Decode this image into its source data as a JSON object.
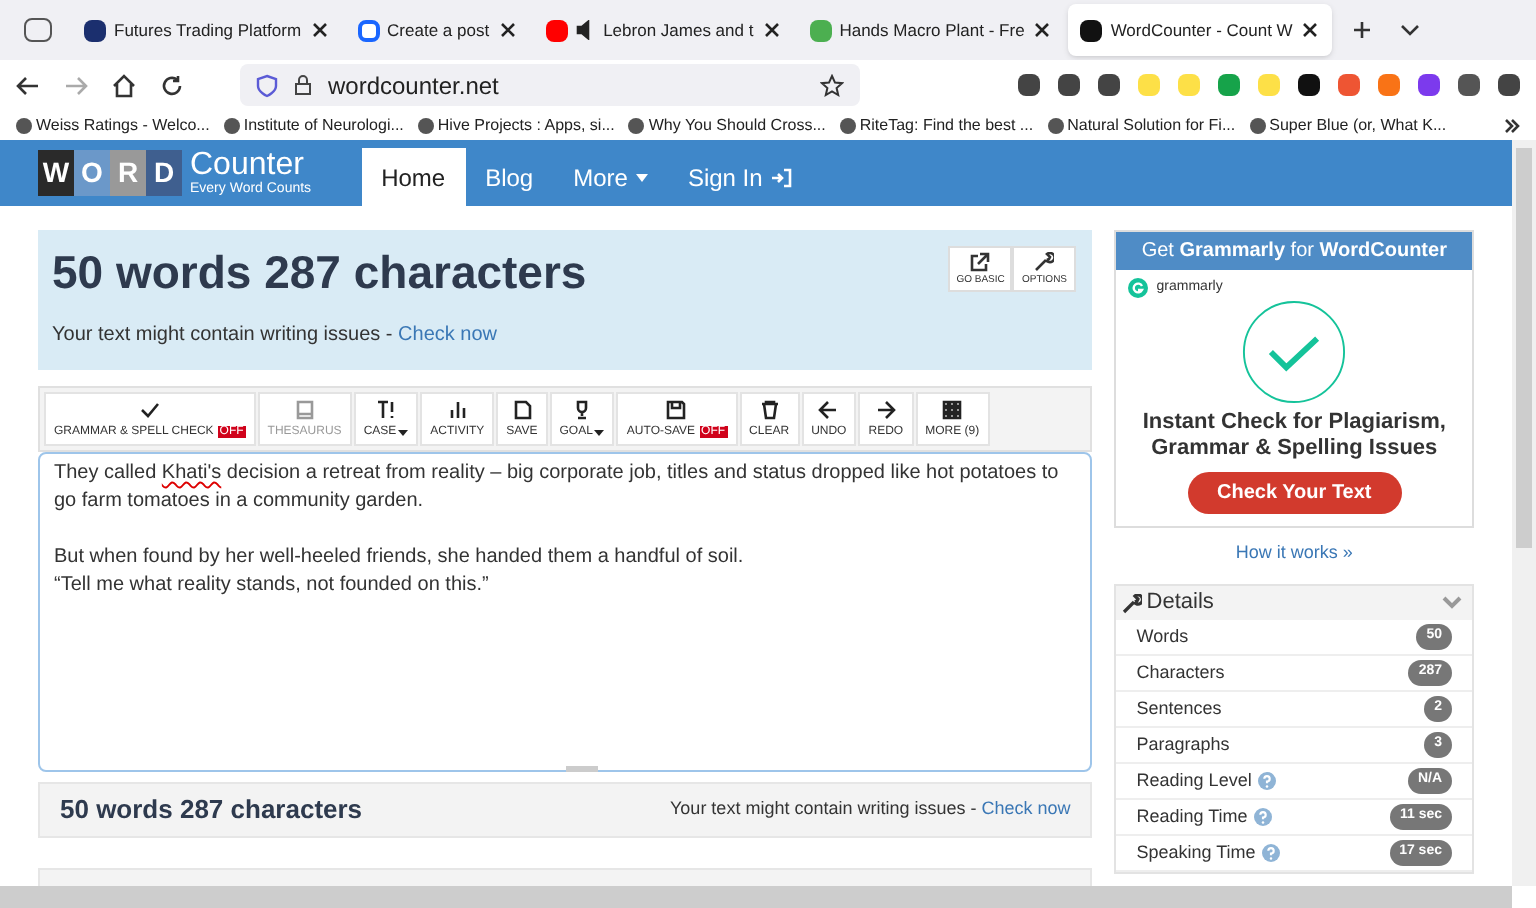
{
  "browser": {
    "tabs": [
      {
        "title": "Futures Trading Platform",
        "selected": false,
        "kind": "navy"
      },
      {
        "title": "Create a post",
        "selected": false,
        "kind": "blue"
      },
      {
        "title": "Lebron James and t",
        "selected": false,
        "kind": "video"
      },
      {
        "title": "Hands Macro Plant - Fre",
        "selected": false,
        "kind": "green"
      },
      {
        "title": "WordCounter - Count W",
        "selected": true,
        "kind": "black"
      }
    ],
    "url": "wordcounter.net",
    "bookmarks": [
      "Weiss Ratings - Welco...",
      "Institute of Neurologi...",
      "Hive Projects : Apps, si...",
      "Why You Should Cross...",
      "RiteTag: Find the best ...",
      "Natural Solution for Fi...",
      "Super Blue (or, What K..."
    ]
  },
  "site": {
    "logo_letters": [
      "W",
      "O",
      "R",
      "D"
    ],
    "logo_word": "Counter",
    "tagline": "Every Word Counts",
    "nav": [
      {
        "label": "Home",
        "selected": true
      },
      {
        "label": "Blog",
        "selected": false
      },
      {
        "label": "More",
        "selected": false
      },
      {
        "label": "Sign In",
        "selected": false
      }
    ]
  },
  "summary": {
    "title": "50 words 287 characters",
    "notice": "Your text might contain writing issues - ",
    "link": "Check now",
    "buttons": [
      "GO BASIC",
      "OPTIONS"
    ]
  },
  "toolbar": [
    {
      "label": "GRAMMAR & SPELL CHECK",
      "badge": "OFF",
      "disabled": false
    },
    {
      "label": "THESAURUS",
      "disabled": true
    },
    {
      "label": "CASE",
      "disabled": false,
      "caret": true
    },
    {
      "label": "ACTIVITY",
      "disabled": false
    },
    {
      "label": "SAVE",
      "disabled": false
    },
    {
      "label": "GOAL",
      "disabled": false,
      "caret": true
    },
    {
      "label": "AUTO-SAVE",
      "badge": "OFF",
      "disabled": false
    },
    {
      "label": "CLEAR",
      "disabled": false
    },
    {
      "label": "UNDO",
      "disabled": false
    },
    {
      "label": "REDO",
      "disabled": false
    },
    {
      "label": "MORE (9)",
      "disabled": false
    }
  ],
  "editor": {
    "paragraphs": [
      [
        "They called ",
        "Khati's",
        " decision a retreat from reality – big corporate job, titles and status dropped like hot potatoes to go farm tomatoes in a community garden."
      ],
      [
        "But when found by her well-heeled friends, she handed them a handful of soil."
      ],
      [
        "“Tell me what reality stands, not founded on this.”"
      ]
    ]
  },
  "footer": {
    "title": "50 words 287 characters",
    "notice": "Your text might contain writing issues - ",
    "link": "Check now"
  },
  "ad": {
    "header": "Get **Grammarly** for **WordCounter**",
    "brand": "grammarly",
    "headline": "Instant Check for Plagiarism, Grammar & Spelling Issues",
    "button": "Check Your Text",
    "link": "How it works »"
  },
  "details": {
    "title": "Details",
    "rows": [
      {
        "label": "Words",
        "value": "50",
        "help": false
      },
      {
        "label": "Characters",
        "value": "287",
        "help": false
      },
      {
        "label": "Sentences",
        "value": "2",
        "help": false
      },
      {
        "label": "Paragraphs",
        "value": "3",
        "help": false
      },
      {
        "label": "Reading Level",
        "value": "N/A",
        "help": true
      },
      {
        "label": "Reading Time",
        "value": "11 sec",
        "help": true
      },
      {
        "label": "Speaking Time",
        "value": "17 sec",
        "help": true
      }
    ]
  }
}
